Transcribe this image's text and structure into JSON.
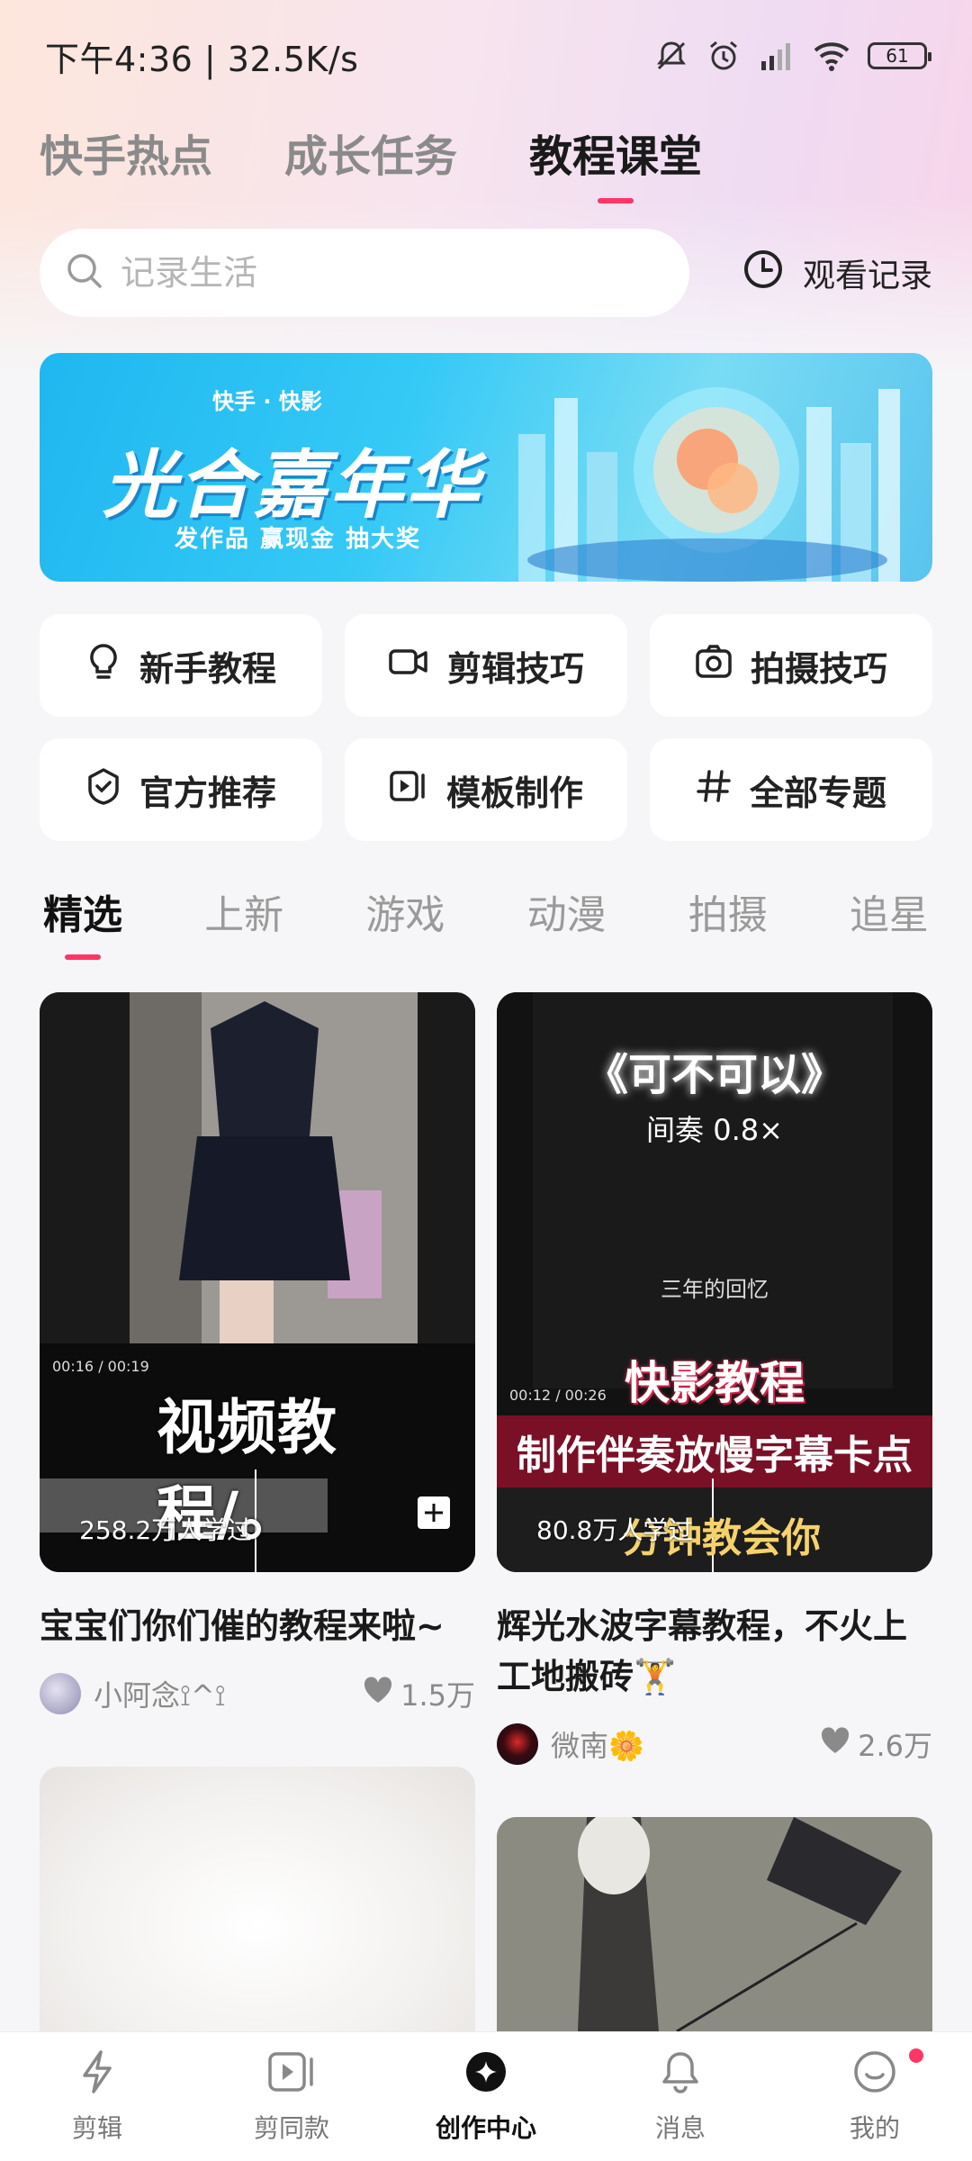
{
  "status_bar": {
    "time_speed": "下午4:36 | 32.5K/s",
    "battery": "61"
  },
  "top_tabs": [
    {
      "label": "快手热点",
      "active": false
    },
    {
      "label": "成长任务",
      "active": false
    },
    {
      "label": "教程课堂",
      "active": true
    }
  ],
  "search": {
    "placeholder": "记录生活",
    "history_label": "观看记录"
  },
  "banner": {
    "logo_text": "快手 · 快影",
    "title": "光合嘉年华",
    "subtitle": "发作品  赢现金  抽大奖"
  },
  "shortcuts": [
    {
      "label": "新手教程",
      "icon": "lightbulb-icon"
    },
    {
      "label": "剪辑技巧",
      "icon": "video-camera-icon"
    },
    {
      "label": "拍摄技巧",
      "icon": "camera-icon"
    },
    {
      "label": "官方推荐",
      "icon": "shield-check-icon"
    },
    {
      "label": "模板制作",
      "icon": "video-template-icon"
    },
    {
      "label": "全部专题",
      "icon": "hashtag-icon"
    }
  ],
  "categories": [
    {
      "label": "精选",
      "active": true
    },
    {
      "label": "上新",
      "active": false
    },
    {
      "label": "游戏",
      "active": false
    },
    {
      "label": "动漫",
      "active": false
    },
    {
      "label": "拍摄",
      "active": false
    },
    {
      "label": "追星",
      "active": false
    }
  ],
  "feed": [
    {
      "learners": "258.2万人学过",
      "title": "宝宝们你们催的教程来啦~",
      "author": "小阿念⟟^⟟",
      "likes": "1.5万",
      "overlay_text": "视频教程/。",
      "player_time": "00:16 / 00:19"
    },
    {
      "learners": "80.8万人学过",
      "title": "辉光水波字幕教程，不火上工地搬砖🏋",
      "author": "微南🌼",
      "likes": "2.6万",
      "overlay_song": "《可不可以》",
      "overlay_speed": "间奏  0.8×",
      "overlay_memory": "三年的回忆",
      "overlay_brand": "快影教程",
      "overlay_desc": "制作伴奏放慢字幕卡点",
      "overlay_teach": "分钟教会你",
      "player_time": "00:12 / 00:26"
    }
  ],
  "bottom_nav": [
    {
      "label": "剪辑",
      "icon": "lightning-icon",
      "active": false
    },
    {
      "label": "剪同款",
      "icon": "play-template-icon",
      "active": false
    },
    {
      "label": "创作中心",
      "icon": "create-center-icon",
      "active": true
    },
    {
      "label": "消息",
      "icon": "bell-icon",
      "active": false
    },
    {
      "label": "我的",
      "icon": "smile-icon",
      "active": false
    }
  ],
  "colors": {
    "accent": "#fe3666",
    "banner_blue": "#1fb7f0"
  }
}
